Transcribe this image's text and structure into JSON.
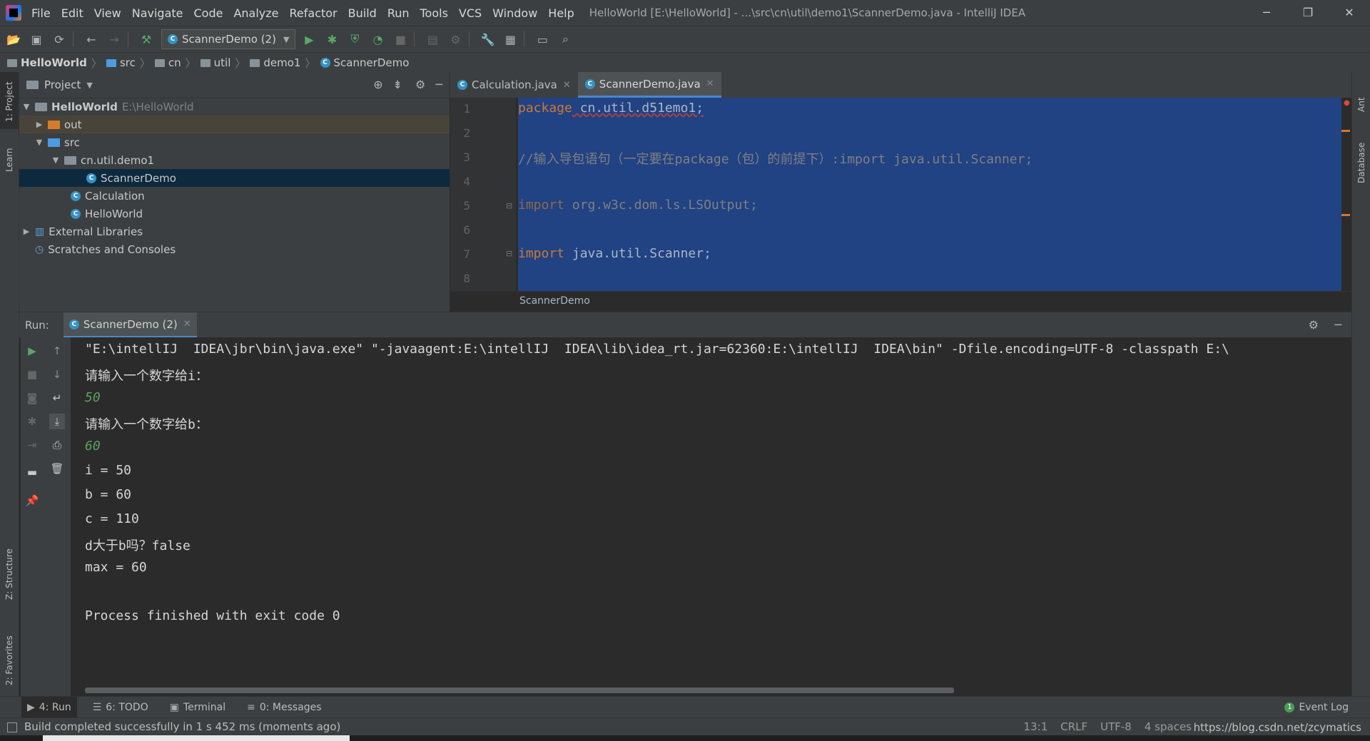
{
  "menu": [
    "File",
    "Edit",
    "View",
    "Navigate",
    "Code",
    "Analyze",
    "Refactor",
    "Build",
    "Run",
    "Tools",
    "VCS",
    "Window",
    "Help"
  ],
  "window_title": "HelloWorld [E:\\HelloWorld] - ...\\src\\cn\\util\\demo1\\ScannerDemo.java - IntelliJ IDEA",
  "toolbar": {
    "run_config": "ScannerDemo (2)"
  },
  "breadcrumb": [
    "HelloWorld",
    "src",
    "cn",
    "util",
    "demo1",
    "ScannerDemo"
  ],
  "left_strip": {
    "project": "1: Project",
    "learn": "Learn",
    "structure": "Z: Structure",
    "favorites": "2: Favorites"
  },
  "right_strip": {
    "ant": "Ant",
    "database": "Database"
  },
  "project_panel": {
    "title": "Project",
    "root_name": "HelloWorld",
    "root_path": "E:\\HelloWorld",
    "out": "out",
    "src": "src",
    "package": "cn.util.demo1",
    "file_scanner": "ScannerDemo",
    "file_calc": "Calculation",
    "file_hello": "HelloWorld",
    "external": "External Libraries",
    "scratches": "Scratches and Consoles"
  },
  "editor": {
    "tabs": [
      "Calculation.java",
      "ScannerDemo.java"
    ],
    "line_numbers": [
      "1",
      "2",
      "3",
      "4",
      "5",
      "6",
      "7",
      "8"
    ],
    "line1_kw": "package",
    "line1_rest": " cn.util.d51emo1;",
    "line3": "//输入导包语句（一定要在package（包）的前提下）:import java.util.Scanner;",
    "line5_kw": "import",
    "line5_rest": " org.w3c.dom.ls.LSOutput;",
    "line7_kw": "import",
    "line7_rest": " java.util.Scanner;",
    "footer": "ScannerDemo"
  },
  "run_panel": {
    "label": "Run:",
    "tab": "ScannerDemo (2)",
    "console": [
      "\"E:\\intellIJ  IDEA\\jbr\\bin\\java.exe\" \"-javaagent:E:\\intellIJ  IDEA\\lib\\idea_rt.jar=62360:E:\\intellIJ  IDEA\\bin\" -Dfile.encoding=UTF-8 -classpath E:\\",
      "请输入一个数字给i：",
      "50",
      "请输入一个数字给b：",
      "60",
      "i = 50",
      "b = 60",
      "c = 110",
      "d大于b吗？false",
      "max = 60",
      "",
      "Process finished with exit code 0"
    ]
  },
  "bottom_tabs": {
    "run": "4: Run",
    "todo": "6: TODO",
    "terminal": "Terminal",
    "messages": "0: Messages",
    "event_log": "Event Log"
  },
  "status": {
    "message": "Build completed successfully in 1 s 452 ms (moments ago)",
    "position": "13:1",
    "line_sep": "CRLF",
    "encoding": "UTF-8",
    "indent": "4 spaces",
    "watermark": "https://blog.csdn.net/zcymatics"
  }
}
